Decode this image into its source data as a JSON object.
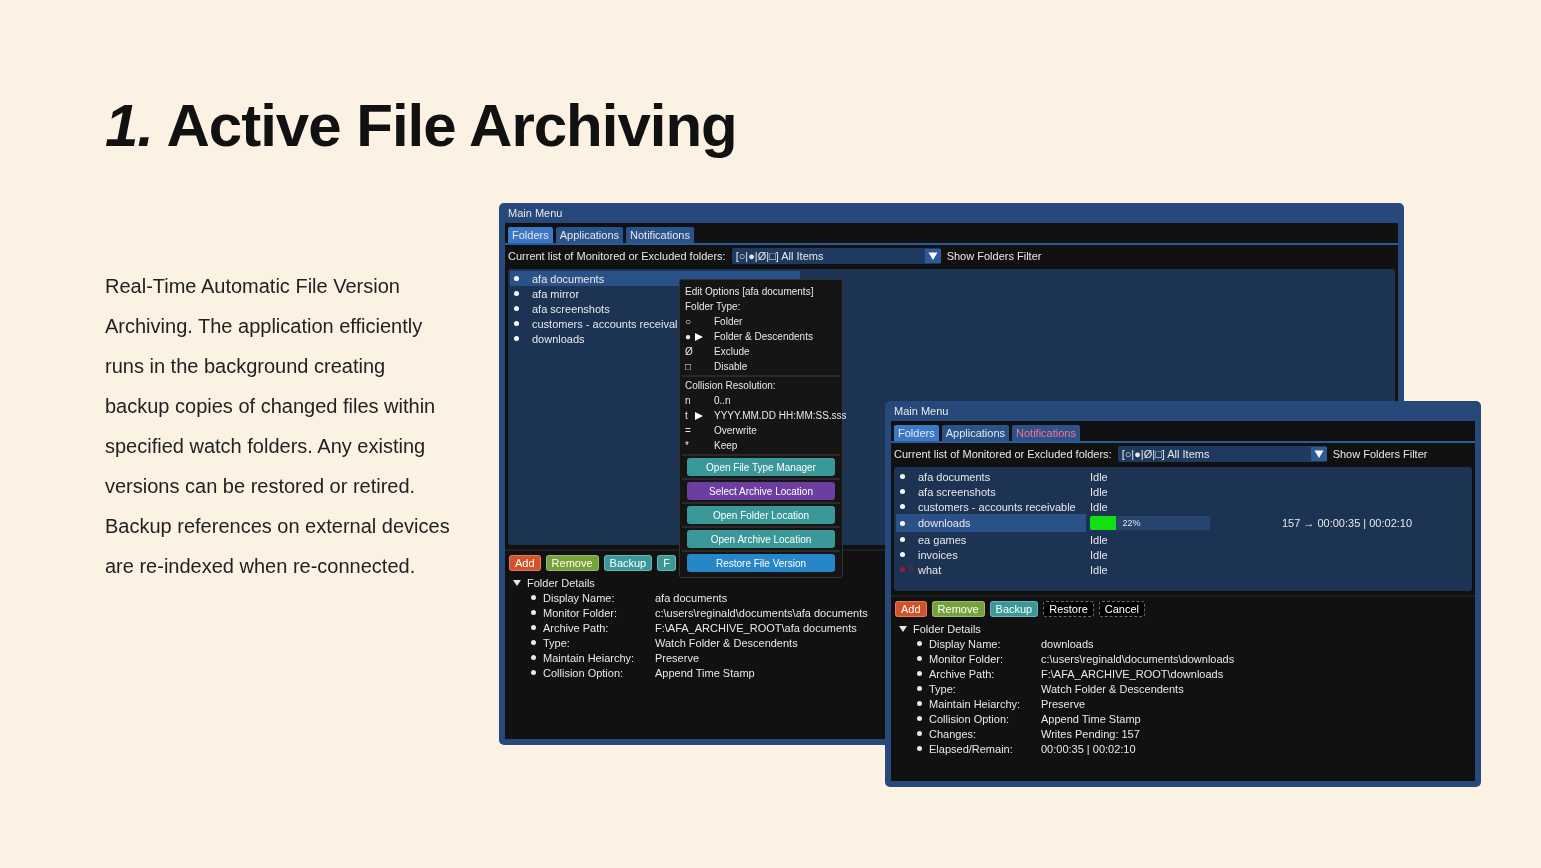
{
  "slide": {
    "title": "*1.* Active File Archiving",
    "description": "Real-Time Automatic File Version Archiving.  The application efficiently runs in the background creating backup copies of changed files within specified watch folders.  Any existing versions can be restored or retired.  Backup references on external devices are re-indexed when re-connected."
  },
  "windows": [
    {
      "title": "Main Menu",
      "tabs": [
        {
          "label": "Folders",
          "selected": true,
          "alert": false
        },
        {
          "label": "Applications",
          "selected": false,
          "alert": false
        },
        {
          "label": "Notifications",
          "selected": false,
          "alert": false
        }
      ],
      "filter": {
        "label": "Current list of Monitored or Excluded folders:",
        "value": "[○|●|Ø|□] All Items",
        "toggle": "Show Folders Filter"
      },
      "folders": [
        {
          "name": "afa documents",
          "color": "#ffffff",
          "selected": true
        },
        {
          "name": "afa mirror",
          "color": "#ffffff",
          "selected": false
        },
        {
          "name": "afa screenshots",
          "color": "#ffffff",
          "selected": false
        },
        {
          "name": "customers - accounts receival",
          "color": "#ffffff",
          "selected": false
        },
        {
          "name": "downloads",
          "color": "#ffffff",
          "selected": false
        }
      ],
      "buttons": [
        {
          "label": "Add",
          "kind": "orange",
          "disabled": false
        },
        {
          "label": "Remove",
          "kind": "green",
          "disabled": false
        },
        {
          "label": "Backup",
          "kind": "teal",
          "disabled": false
        },
        {
          "label": "F",
          "kind": "teal",
          "disabled": false
        }
      ],
      "details": {
        "title": "Folder Details",
        "expanded": true,
        "rows": [
          {
            "label": "Display Name:",
            "value": "afa documents"
          },
          {
            "label": "Monitor Folder:",
            "value": "c:\\users\\reginald\\documents\\afa documents"
          },
          {
            "label": "Archive Path:",
            "value": "F:\\AFA_ARCHIVE_ROOT\\afa documents"
          },
          {
            "label": "Type:",
            "value": "Watch Folder & Descendents"
          },
          {
            "label": "Maintain Heiarchy:",
            "value": "Preserve"
          },
          {
            "label": "Collision Option:",
            "value": "Append Time Stamp"
          }
        ]
      },
      "context_menu": {
        "title": "Edit Options [afa documents]",
        "sections": [
          {
            "heading": "Folder Type:",
            "options": [
              {
                "mark": "○",
                "label": "Folder",
                "selected": false
              },
              {
                "mark": "●",
                "label": "Folder & Descendents",
                "selected": true
              },
              {
                "mark": "Ø",
                "label": "Exclude",
                "selected": false
              },
              {
                "mark": "□",
                "label": "Disable",
                "selected": false
              }
            ]
          },
          {
            "heading": "Collision Resolution:",
            "options": [
              {
                "mark": "n",
                "label": "0..n",
                "selected": false
              },
              {
                "mark": "t",
                "label": "YYYY.MM.DD HH:MM:SS.sss",
                "selected": true
              },
              {
                "mark": "=",
                "label": "Overwrite",
                "selected": false
              },
              {
                "mark": "*",
                "label": "Keep",
                "selected": false
              }
            ]
          }
        ],
        "actions": [
          {
            "label": "Open File Type Manager",
            "kind": "teal"
          },
          {
            "label": "Select Archive Location",
            "kind": "purple"
          },
          {
            "label": "Open Folder Location",
            "kind": "teal"
          },
          {
            "label": "Open Archive Location",
            "kind": "teal"
          },
          {
            "label": "Restore File Version",
            "kind": "blue"
          }
        ]
      }
    },
    {
      "title": "Main Menu",
      "tabs": [
        {
          "label": "Folders",
          "selected": true,
          "alert": false
        },
        {
          "label": "Applications",
          "selected": false,
          "alert": false
        },
        {
          "label": "Notifications",
          "selected": false,
          "alert": true
        }
      ],
      "filter": {
        "label": "Current list of Monitored or Excluded folders:",
        "value": "[○|●|Ø|□] All Items",
        "toggle": "Show Folders Filter"
      },
      "folders": [
        {
          "name": "afa documents",
          "color": "#ffffff",
          "selected": false,
          "status": {
            "kind": "text",
            "text": "Idle"
          }
        },
        {
          "name": "afa screenshots",
          "color": "#ffffff",
          "selected": false,
          "status": {
            "kind": "text",
            "text": "Idle"
          }
        },
        {
          "name": "customers - accounts receivable",
          "color": "#ffffff",
          "selected": false,
          "status": {
            "kind": "text",
            "text": "Idle"
          }
        },
        {
          "name": "downloads",
          "color": "#ffffff",
          "selected": true,
          "status": {
            "kind": "progress",
            "level": 0.22,
            "reading": "22%",
            "detail": "157 → 00:00:35 | 00:02:10"
          }
        },
        {
          "name": "ea games",
          "color": "#ffffff",
          "selected": false,
          "status": {
            "kind": "text",
            "text": "Idle"
          }
        },
        {
          "name": "invoices",
          "color": "#ffffff",
          "selected": false,
          "status": {
            "kind": "text",
            "text": "Idle"
          }
        },
        {
          "name": "what",
          "color": "#a0182c",
          "flag": "!!",
          "selected": false,
          "status": {
            "kind": "text",
            "text": "Idle"
          }
        }
      ],
      "buttons": [
        {
          "label": "Add",
          "kind": "orange",
          "disabled": false
        },
        {
          "label": "Remove",
          "kind": "green",
          "disabled": false
        },
        {
          "label": "Backup",
          "kind": "teal",
          "disabled": false
        },
        {
          "label": "Restore",
          "kind": "teal",
          "disabled": true
        },
        {
          "label": "Cancel",
          "kind": "teal",
          "disabled": true
        }
      ],
      "details": {
        "title": "Folder Details",
        "expanded": true,
        "rows": [
          {
            "label": "Display Name:",
            "value": "downloads"
          },
          {
            "label": "Monitor Folder:",
            "value": "c:\\users\\reginald\\documents\\downloads"
          },
          {
            "label": "Archive Path:",
            "value": "F:\\AFA_ARCHIVE_ROOT\\downloads"
          },
          {
            "label": "Type:",
            "value": "Watch Folder & Descendents"
          },
          {
            "label": "Maintain Heiarchy:",
            "value": "Preserve"
          },
          {
            "label": "Collision Option:",
            "value": "Append Time Stamp"
          },
          {
            "label": "Changes:",
            "value": "Writes Pending: 157"
          },
          {
            "label": "Elapsed/Remain:",
            "value": "00:00:35 | 00:02:10"
          }
        ]
      }
    }
  ]
}
